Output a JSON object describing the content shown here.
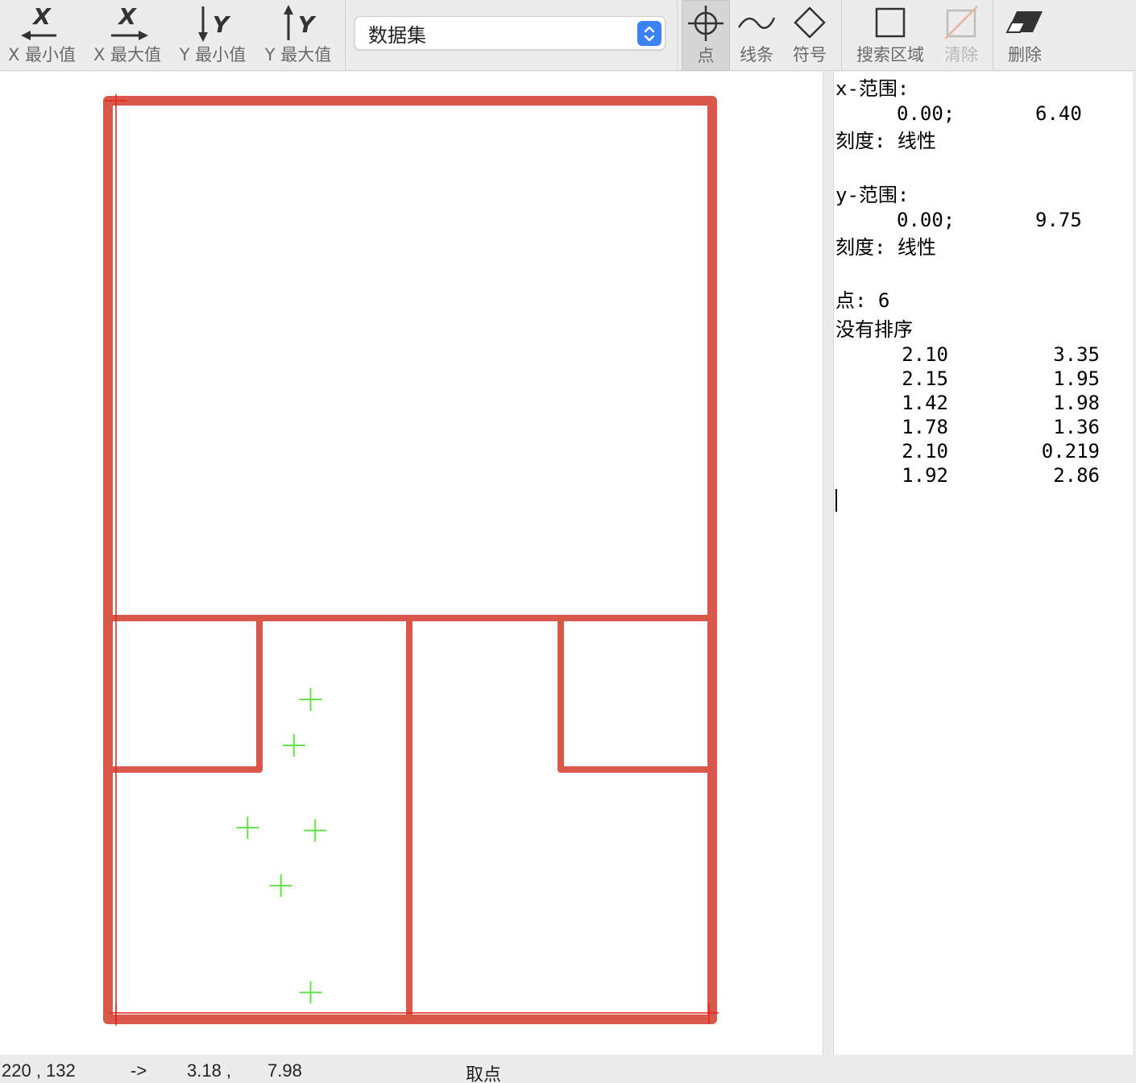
{
  "toolbar": {
    "x_min_label": "X 最小值",
    "x_max_label": "X 最大值",
    "y_min_label": "Y 最小值",
    "y_max_label": "Y 最大值",
    "dataset_value": "数据集",
    "point_label": "点",
    "line_label": "线条",
    "symbol_label": "符号",
    "search_area_label": "搜索区域",
    "clear_label": "清除",
    "delete_label": "删除"
  },
  "info": {
    "x_range_label": "x-范围:",
    "x_min": "0.00;",
    "x_max": "6.40",
    "x_scale": "刻度: 线性",
    "y_range_label": "y-范围:",
    "y_min": "0.00;",
    "y_max": "9.75",
    "y_scale": "刻度: 线性",
    "points_label": "点: 6",
    "sort_label": "没有排序",
    "points": [
      {
        "x": "2.10",
        "y": "3.35"
      },
      {
        "x": "2.15",
        "y": "1.95"
      },
      {
        "x": "1.42",
        "y": "1.98"
      },
      {
        "x": "1.78",
        "y": "1.36"
      },
      {
        "x": "2.10",
        "y": "0.219"
      },
      {
        "x": "1.92",
        "y": "2.86"
      }
    ]
  },
  "status": {
    "pixel_coords": "220 , 132",
    "arrow": "->",
    "data_x": "3.18 ,",
    "data_y": "7.98",
    "mode": "取点"
  },
  "colors": {
    "floorplan_wall": "#d9584a",
    "point_marker": "#66e04a",
    "axis_marker": "#e8231a",
    "accent": "#3b82f6"
  },
  "icons": [
    "x-min-icon",
    "x-max-icon",
    "y-min-icon",
    "y-max-icon",
    "crosshair-icon",
    "curve-icon",
    "diamond-icon",
    "square-icon",
    "clear-icon",
    "eraser-icon"
  ]
}
